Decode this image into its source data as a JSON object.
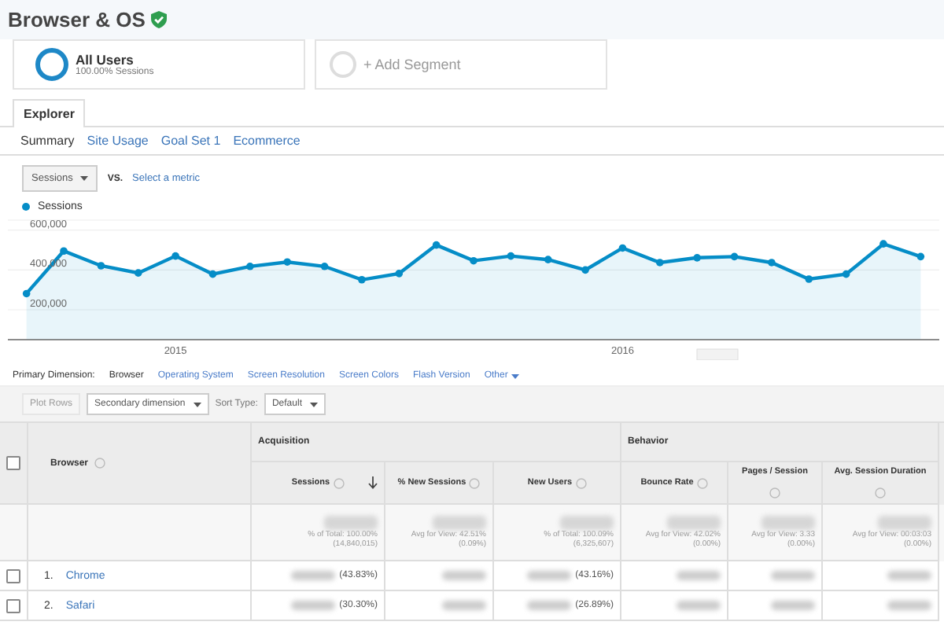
{
  "title": "Browser & OS",
  "segments": [
    {
      "kind": "active",
      "name": "All Users",
      "subtitle": "100.00% Sessions"
    },
    {
      "kind": "add",
      "name": "+ Add Segment"
    }
  ],
  "tabs": [
    {
      "label": "Explorer",
      "selected": true
    }
  ],
  "subtabs": [
    {
      "label": "Summary",
      "selected": true
    },
    {
      "label": "Site Usage",
      "selected": false
    },
    {
      "label": "Goal Set 1",
      "selected": false
    },
    {
      "label": "Ecommerce",
      "selected": false
    }
  ],
  "metric": {
    "value": "Sessions",
    "vs": "VS.",
    "link": "Select a metric"
  },
  "chart": {
    "chart_data": {
      "type": "area",
      "series": [
        {
          "name": "Sessions",
          "color": "#058dc7",
          "values": [
            281000,
            495000,
            421000,
            385000,
            470000,
            379000,
            418000,
            440000,
            418000,
            351000,
            382000,
            525000,
            446000,
            470000,
            452000,
            400000,
            510000,
            437000,
            461000,
            467000,
            437000,
            354000,
            379000,
            531000,
            467000
          ]
        }
      ],
      "categories": [
        null,
        null,
        null,
        null,
        "2015",
        null,
        null,
        null,
        null,
        null,
        null,
        null,
        null,
        null,
        null,
        null,
        "2016",
        null,
        null,
        null,
        null,
        null,
        null,
        null,
        null
      ],
      "grid": true,
      "ylim": [
        50000,
        650000
      ],
      "yticks": [
        {
          "value": 200000,
          "label": "200,000"
        },
        {
          "value": 400000,
          "label": "400,000"
        },
        {
          "value": 600000,
          "label": "600,000"
        }
      ]
    }
  },
  "primary_dimension": {
    "label": "Primary Dimension:",
    "options": [
      {
        "label": "Browser",
        "selected": true
      },
      {
        "label": "Operating System",
        "selected": false
      },
      {
        "label": "Screen Resolution",
        "selected": false
      },
      {
        "label": "Screen Colors",
        "selected": false
      },
      {
        "label": "Flash Version",
        "selected": false
      },
      {
        "label": "Other",
        "selected": false
      }
    ]
  },
  "toolbar": {
    "plot_rows": {
      "label": "Plot Rows",
      "disabled": true
    },
    "secondary": "Secondary dimension",
    "sort_label": "Sort Type:",
    "sort_value": "Default"
  },
  "table": {
    "groups": [
      "Acquisition",
      "Behavior"
    ],
    "first_column": "Browser",
    "all_checked": false,
    "columns": [
      {
        "label": "Sessions",
        "sorted": true
      },
      {
        "label": "% New Sessions",
        "sorted": false
      },
      {
        "label": "New Users",
        "sorted": false
      },
      {
        "label": "Bounce Rate",
        "sorted": false
      },
      {
        "label": "Pages / Session",
        "sorted": false
      },
      {
        "label": "Avg. Session Duration",
        "sorted": false
      }
    ],
    "totals": [
      {
        "note": "% of Total: 100.00%",
        "detail": "(14,840,015)"
      },
      {
        "note": "Avg for View: 42.51%",
        "detail": "(0.09%)"
      },
      {
        "note": "% of Total: 100.09%",
        "detail": "(6,325,607)"
      },
      {
        "note": "Avg for View: 42.02%",
        "detail": "(0.00%)"
      },
      {
        "note": "Avg for View: 3.33",
        "detail": "(0.00%)"
      },
      {
        "note": "Avg for View: 00:03:03",
        "detail": "(0.00%)"
      }
    ],
    "rows": [
      {
        "index": "1.",
        "name": "Chrome",
        "checked": false,
        "cells": [
          {
            "blurred": true,
            "share": "(43.83%)"
          },
          {
            "blurred": true
          },
          {
            "blurred": true,
            "share": "(43.16%)"
          },
          {
            "blurred": true
          },
          {
            "blurred": true
          },
          {
            "blurred": true
          }
        ]
      },
      {
        "index": "2.",
        "name": "Safari",
        "checked": false,
        "cells": [
          {
            "blurred": true,
            "share": "(30.30%)"
          },
          {
            "blurred": true
          },
          {
            "blurred": true,
            "share": "(26.89%)"
          },
          {
            "blurred": true
          },
          {
            "blurred": true
          },
          {
            "blurred": true
          }
        ]
      }
    ]
  }
}
